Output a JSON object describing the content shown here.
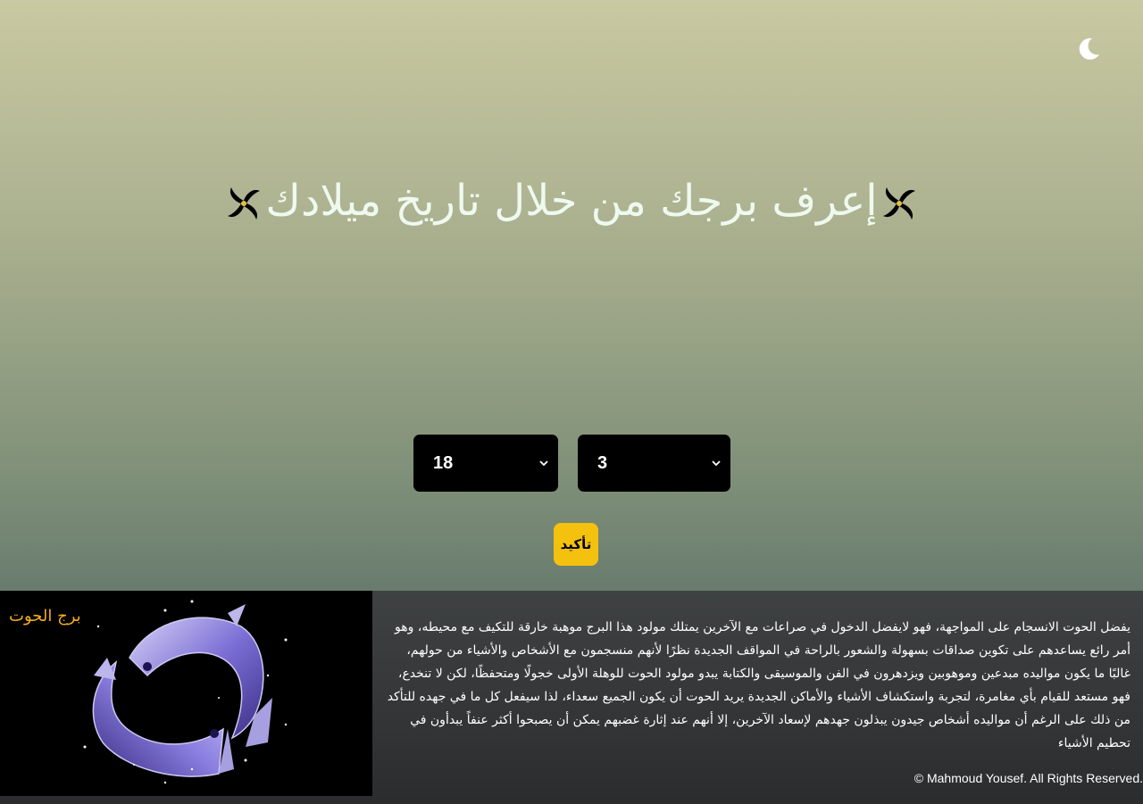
{
  "header": {
    "theme_toggle_icon": "moon-icon"
  },
  "hero": {
    "title": "إعرف برجك من خلال تاريخ ميلادك",
    "decor_icon": "fan-icon"
  },
  "form": {
    "day_value": "18",
    "month_value": "3",
    "confirm_label": "تأكيد"
  },
  "result": {
    "sign_name": "برج الحوت",
    "description": "يفضل الحوت الانسجام على المواجهة، فهو لايفضل الدخول في صراعات مع الآخرين يمتلك مولود هذا البرج موهبة خارقة للتكيف مع محيطه، وهو أمر رائع يساعدهم على تكوين صداقات بسهولة والشعور بالراحة في المواقف الجديدة نظرًا لأنهم منسجمون مع الأشخاص والأشياء من حولهم، غالبًا ما يكون مواليده مبدعين وموهوبين ويزدهرون في الفن والموسيقى والكتابة يبدو مولود الحوت للوهلة الأولى خجولًا ومتحفظًا، لكن لا تنخدع، فهو مستعد للقيام بأي مغامرة، لتجربة واستكشاف الأشياء والأماكن الجديدة يريد الحوت أن يكون الجميع سعداء، لذا سيفعل كل ما في جهده للتأكد من ذلك على الرغم أن مواليده أشخاص جيدون يبذلون جهدهم لإسعاد الآخرين، إلا أنهم عند إثارة غضبهم يمكن أن يصبحوا أكثر عنفاً يبدأون في تحطيم الأشياء",
    "image_icon": "pisces-fish-icon"
  },
  "footer": {
    "copyright": "© Mahmoud Yousef. All Rights Reserved."
  },
  "colors": {
    "accent": "#f4c10f",
    "sign_title": "#f2ad1d"
  }
}
